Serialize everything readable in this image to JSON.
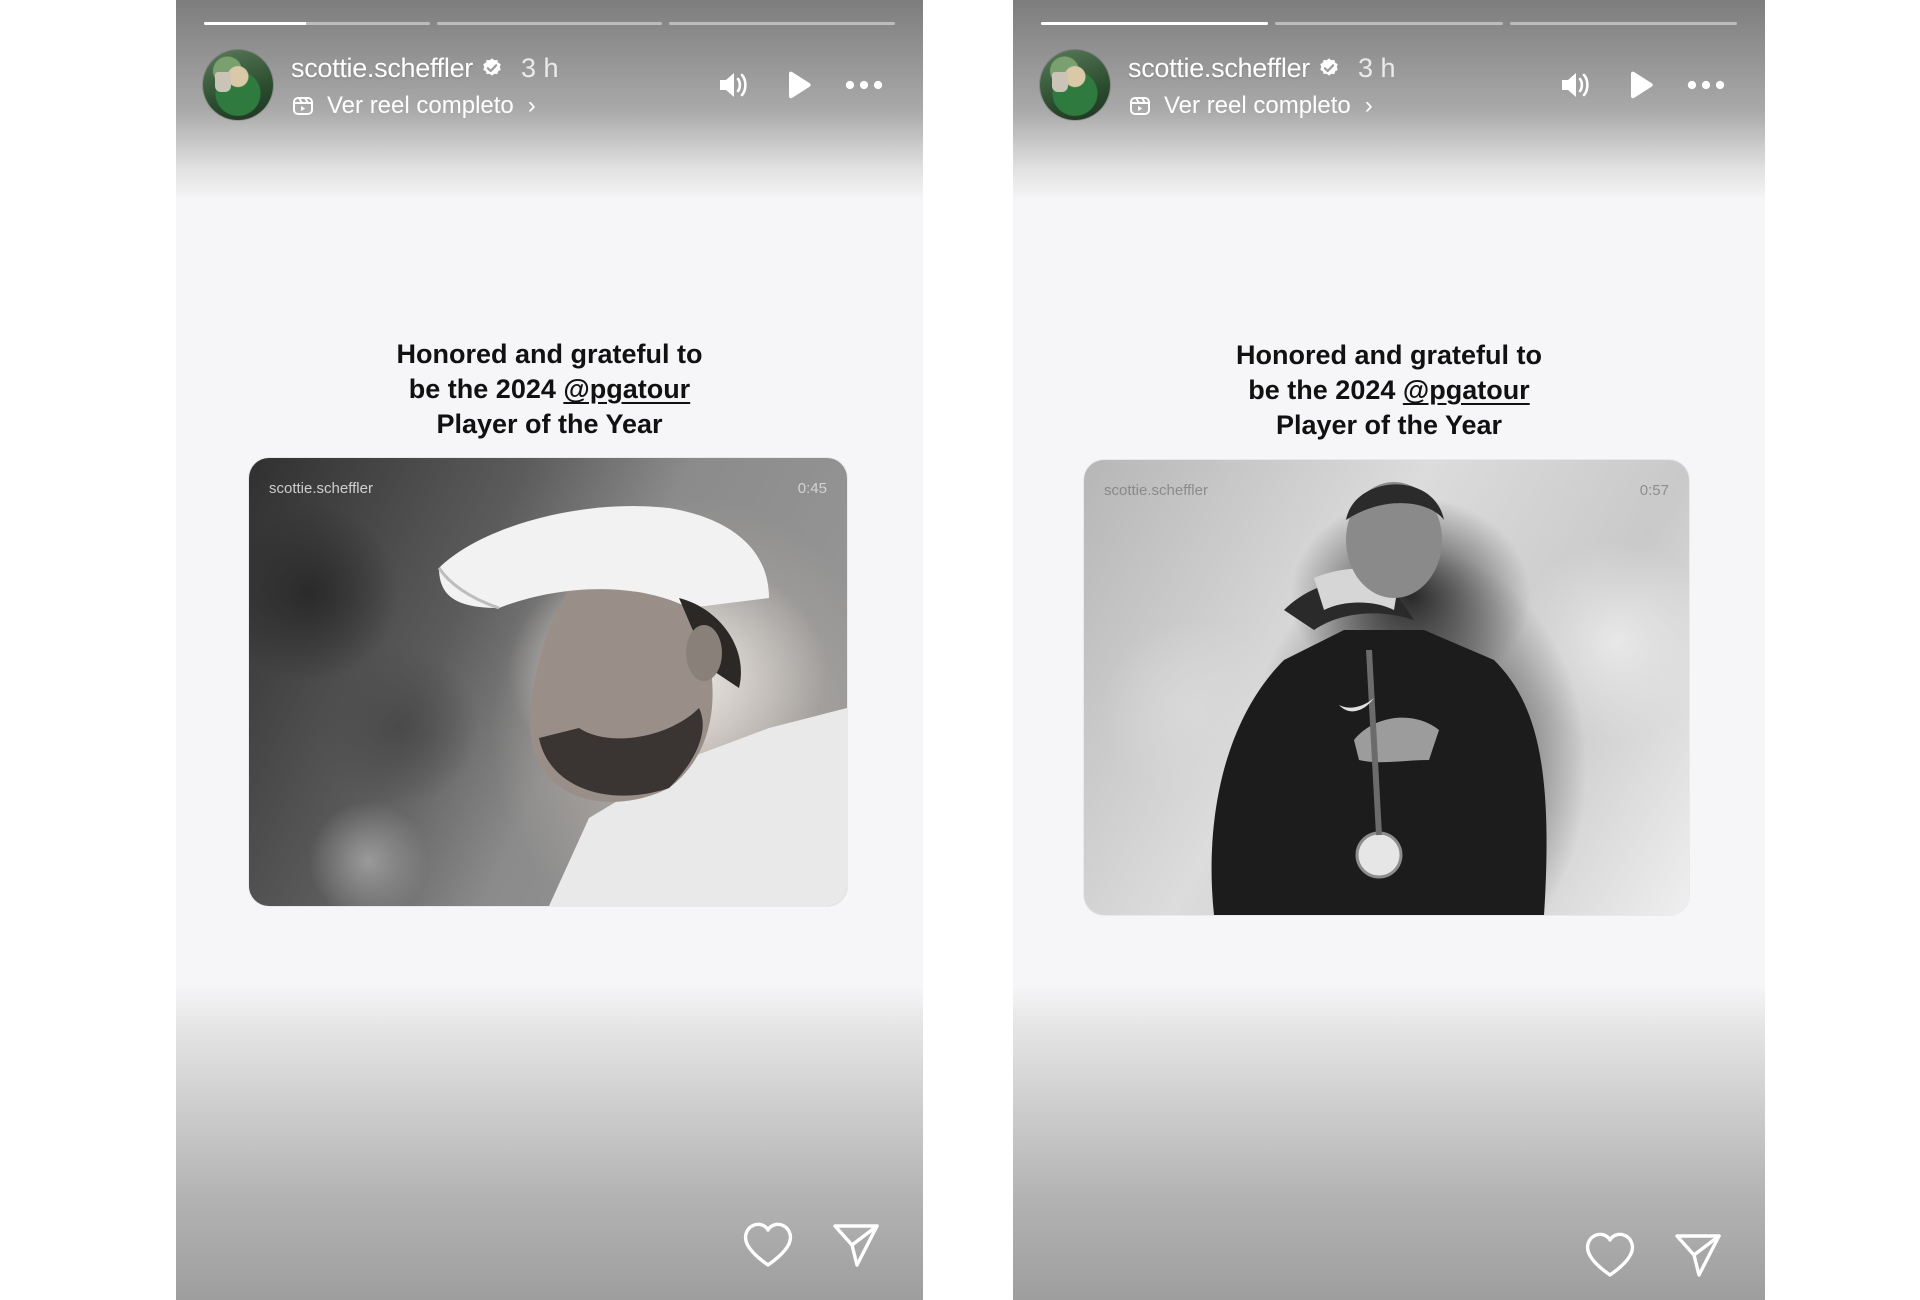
{
  "stories": [
    {
      "progress": [
        0.45,
        0,
        0
      ],
      "username": "scottie.scheffler",
      "time_ago": "3 h",
      "reel_link": "Ver reel completo",
      "caption": {
        "line1": "Honored and grateful to",
        "line2_prefix": "be the 2024 ",
        "mention": "@pgatour",
        "line3": "Player of the Year"
      },
      "photo": {
        "watermark_user": "scottie.scheffler",
        "watermark_time": "0:45",
        "subject": "smiling golfer in white cap, black and white"
      }
    },
    {
      "progress": [
        1,
        0,
        0
      ],
      "username": "scottie.scheffler",
      "time_ago": "3 h",
      "reel_link": "Ver reel completo",
      "caption": {
        "line1": "Honored and grateful to",
        "line2_prefix": "be the 2024 ",
        "mention": "@pgatour",
        "line3": "Player of the Year"
      },
      "photo": {
        "watermark_user": "scottie.scheffler",
        "watermark_time": "0:57",
        "subject": "golfer with medal wiping face, black and white"
      }
    }
  ],
  "icons": {
    "verified": "verified-badge-icon",
    "reel": "reel-icon",
    "sound": "speaker-icon",
    "play": "play-icon",
    "more": "more-dots-icon",
    "like": "heart-icon",
    "share": "send-icon"
  }
}
